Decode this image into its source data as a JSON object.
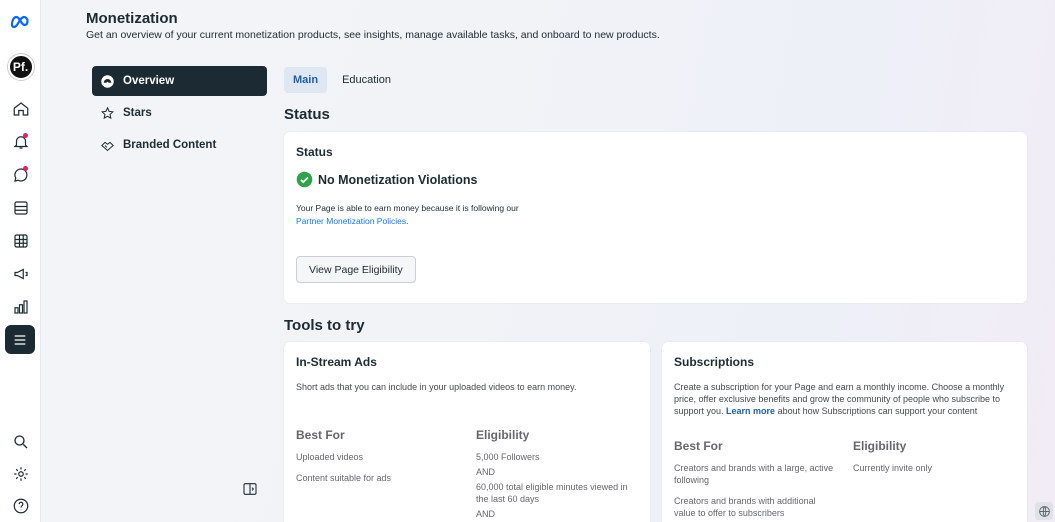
{
  "header": {
    "title": "Monetization",
    "subtitle": "Get an overview of your current monetization products, see insights, manage available tasks, and onboard to new products."
  },
  "rail": {
    "avatar_text": "Pf."
  },
  "nav": {
    "items": [
      {
        "label": "Overview",
        "icon": "overview-icon",
        "active": true
      },
      {
        "label": "Stars",
        "icon": "stars-icon"
      },
      {
        "label": "Branded Content",
        "icon": "handshake-icon"
      }
    ]
  },
  "tabs": [
    {
      "label": "Main",
      "active": true
    },
    {
      "label": "Education"
    }
  ],
  "status_section": {
    "heading": "Status",
    "card_title": "Status",
    "violation_text": "No Monetization Violations",
    "desc": "Your Page is able to earn money because it is following our",
    "link": "Partner Monetization Policies",
    "link_suffix": ".",
    "button": "View Page Eligibility"
  },
  "tools": {
    "heading": "Tools to try",
    "instream": {
      "title": "In-Stream Ads",
      "desc": "Short ads that you can include in your uploaded videos to earn money.",
      "best_for_label": "Best For",
      "eligibility_label": "Eligibility",
      "best_for": [
        "Uploaded videos",
        "Content suitable for ads"
      ],
      "eligibility": [
        "5,000 Followers",
        "AND",
        "60,000 total eligible minutes viewed in the last 60 days",
        "AND"
      ]
    },
    "subscriptions": {
      "title": "Subscriptions",
      "desc_pre": "Create a subscription for your Page and earn a monthly income. Choose a monthly price, offer exclusive benefits and grow the community of people who subscribe to support you.",
      "desc_link": "Learn more",
      "desc_post": "about how Subscriptions can support your content",
      "best_for_label": "Best For",
      "eligibility_label": "Eligibility",
      "best_for": [
        "Creators and brands with a large, active following",
        "Creators and brands with additional value to offer to subscribers"
      ],
      "eligibility": [
        "Currently invite only"
      ]
    }
  },
  "colors": {
    "accent": "#1877f2",
    "success": "#31a24c",
    "dark": "#1c2b33"
  }
}
